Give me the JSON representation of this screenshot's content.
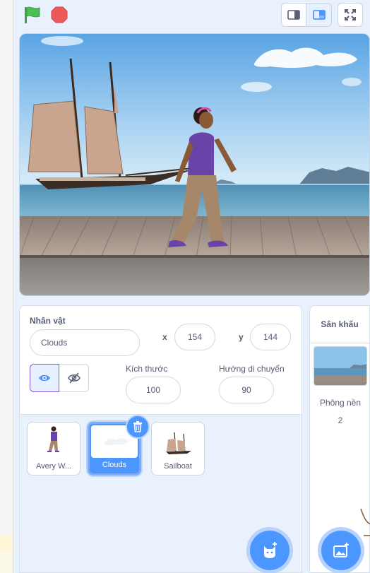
{
  "toolbar": {
    "green_flag": "green-flag-icon",
    "stop": "stop-icon",
    "small_stage": "small-stage-icon",
    "normal_stage": "normal-stage-icon",
    "fullscreen": "fullscreen-icon"
  },
  "sprite_info": {
    "sprite_label": "Nhân vật",
    "sprite_name": "Clouds",
    "x_label": "x",
    "x_value": "154",
    "y_label": "y",
    "y_value": "144",
    "show_label": "Kích thước",
    "size_value": "100",
    "direction_label": "Hướng di chuyển",
    "direction_value": "90"
  },
  "sprites": [
    {
      "name": "Avery W...",
      "selected": false
    },
    {
      "name": "Clouds",
      "selected": true
    },
    {
      "name": "Sailboat",
      "selected": false
    }
  ],
  "stage_panel": {
    "title": "Sân khấu",
    "backdrops_label": "Phông nền",
    "backdrops_count": "2"
  },
  "colors": {
    "accent": "#4c97ff",
    "panel_bg": "#e9f1fc",
    "flag_green": "#4cbf56",
    "stop_red": "#ec5959"
  }
}
